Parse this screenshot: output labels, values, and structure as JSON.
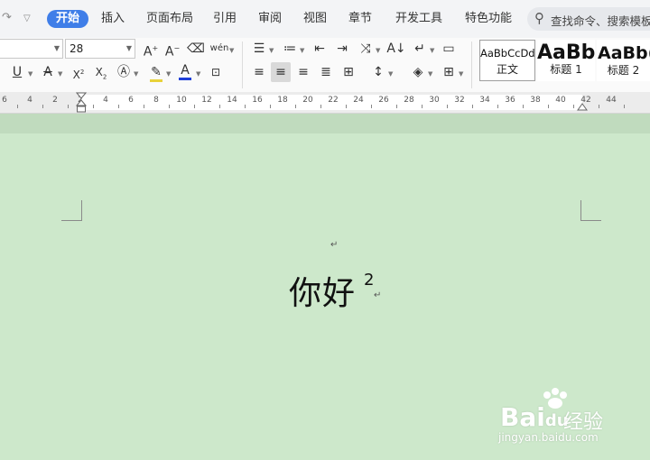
{
  "menu": {
    "tabs": [
      {
        "label": "开始",
        "active": true
      },
      {
        "label": "插入"
      },
      {
        "label": "页面布局"
      },
      {
        "label": "引用"
      },
      {
        "label": "审阅"
      },
      {
        "label": "视图"
      },
      {
        "label": "章节"
      },
      {
        "label": "开发工具"
      },
      {
        "label": "特色功能"
      }
    ],
    "search_placeholder": "查找命令、搜索模板"
  },
  "ribbon": {
    "font_size": "28",
    "pinyin_button_label": "wén",
    "styles": [
      {
        "sample": "AaBbCcDd",
        "name": "正文"
      },
      {
        "sample": "AaBb",
        "name": "标题 1"
      },
      {
        "sample": "AaBb(",
        "name": "标题 2"
      }
    ]
  },
  "ruler": {
    "labels": [
      "6",
      "4",
      "2",
      "2",
      "4",
      "6",
      "8",
      "10",
      "12",
      "14",
      "16",
      "18",
      "20",
      "22",
      "24",
      "26",
      "28",
      "30",
      "32",
      "34",
      "36",
      "38",
      "40",
      "42",
      "44"
    ]
  },
  "document": {
    "text": "你好",
    "superscript": "2",
    "paragraph_mark": "↵"
  },
  "watermark": {
    "logo": "Bai",
    "logo_tail": "du",
    "sub": "经验",
    "url": "jingyan.baidu.com"
  },
  "colors": {
    "page_background": "#cde8cb",
    "accent_tab": "#3f7ee8",
    "font_color_underline": "#1f3fd8",
    "highlight_underline": "#e8d23a"
  }
}
